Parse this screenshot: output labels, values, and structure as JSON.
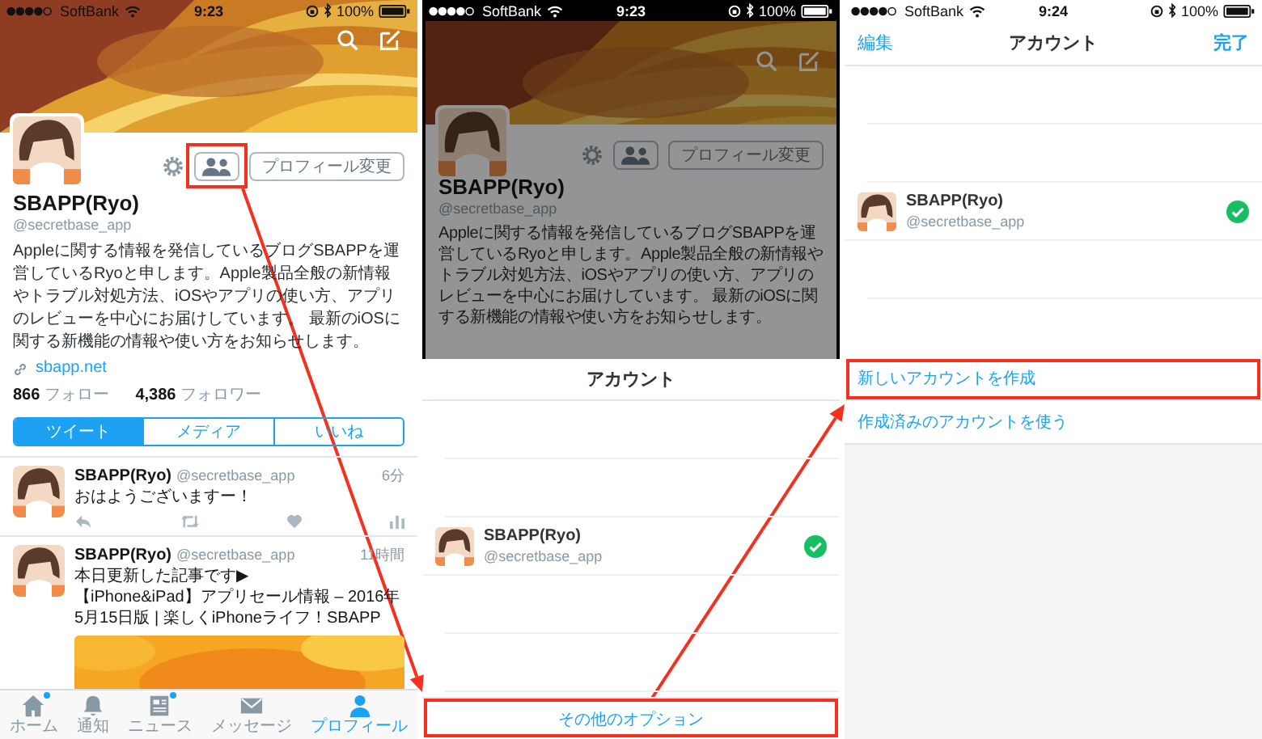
{
  "screens": [
    {
      "kind": "profile",
      "status_bar": {
        "carrier": "SoftBank",
        "time": "9:23",
        "battery": "100%"
      },
      "profile": {
        "name": "SBAPP(Ryo)",
        "handle": "@secretbase_app",
        "bio": "Appleに関する情報を発信しているブログSBAPPを運営しているRyoと申します。Apple製品全般の新情報やトラブル対処方法、iOSやアプリの使い方、アプリのレビューを中心にお届けしています。 最新のiOSに関する新機能の情報や使い方をお知らせします。",
        "link": "sbapp.net",
        "following_count": "866",
        "following_label": "フォロー",
        "followers_count": "4,386",
        "followers_label": "フォロワー",
        "edit_button": "プロフィール変更",
        "friends_button_highlighted": true
      },
      "tabs": [
        {
          "label": "ツイート",
          "selected": true
        },
        {
          "label": "メディア",
          "selected": false
        },
        {
          "label": "いいね",
          "selected": false
        }
      ],
      "tweets": [
        {
          "name": "SBAPP(Ryo)",
          "handle": "@secretbase_app",
          "time": "6分",
          "text": "おはようございますー！",
          "has_actions": true,
          "has_media": false
        },
        {
          "name": "SBAPP(Ryo)",
          "handle": "@secretbase_app",
          "time": "11時間",
          "text": "本日更新した記事です▶\n【iPhone&iPad】アプリセール情報 – 2016年5月15日版 | 楽しくiPhoneライフ！SBAPP",
          "has_actions": false,
          "has_media": true
        }
      ],
      "tab_bar": [
        {
          "label": "ホーム",
          "selected": false,
          "badge": true
        },
        {
          "label": "通知",
          "selected": false,
          "badge": false
        },
        {
          "label": "ニュース",
          "selected": false,
          "badge": true
        },
        {
          "label": "メッセージ",
          "selected": false,
          "badge": false
        },
        {
          "label": "プロフィール",
          "selected": true,
          "badge": false
        }
      ]
    },
    {
      "kind": "account_sheet",
      "status_bar": {
        "carrier": "SoftBank",
        "time": "9:23",
        "battery": "100%"
      },
      "profile": {
        "name": "SBAPP(Ryo)",
        "handle": "@secretbase_app",
        "bio": "Appleに関する情報を発信しているブログSBAPPを運営しているRyoと申します。Apple製品全般の新情報やトラブル対処方法、iOSやアプリの使い方、アプリのレビューを中心にお届けしています。 最新のiOSに関する新機能の情報や使い方をお知らせします。",
        "edit_button": "プロフィール変更"
      },
      "title": "アカウント",
      "accounts": [
        {
          "name": "SBAPP(Ryo)",
          "handle": "@secretbase_app",
          "selected": true
        }
      ],
      "option_button": {
        "label": "その他のオプション",
        "highlighted": true
      }
    },
    {
      "kind": "account_list",
      "status_bar": {
        "carrier": "SoftBank",
        "time": "9:24",
        "battery": "100%"
      },
      "nav": {
        "left": "編集",
        "title": "アカウント",
        "right": "完了"
      },
      "accounts": [
        {
          "name": "SBAPP(Ryo)",
          "handle": "@secretbase_app",
          "selected": true
        }
      ],
      "actions": [
        {
          "label": "新しいアカウントを作成",
          "highlighted": true
        },
        {
          "label": "作成済みのアカウントを使う",
          "highlighted": false
        }
      ]
    }
  ]
}
